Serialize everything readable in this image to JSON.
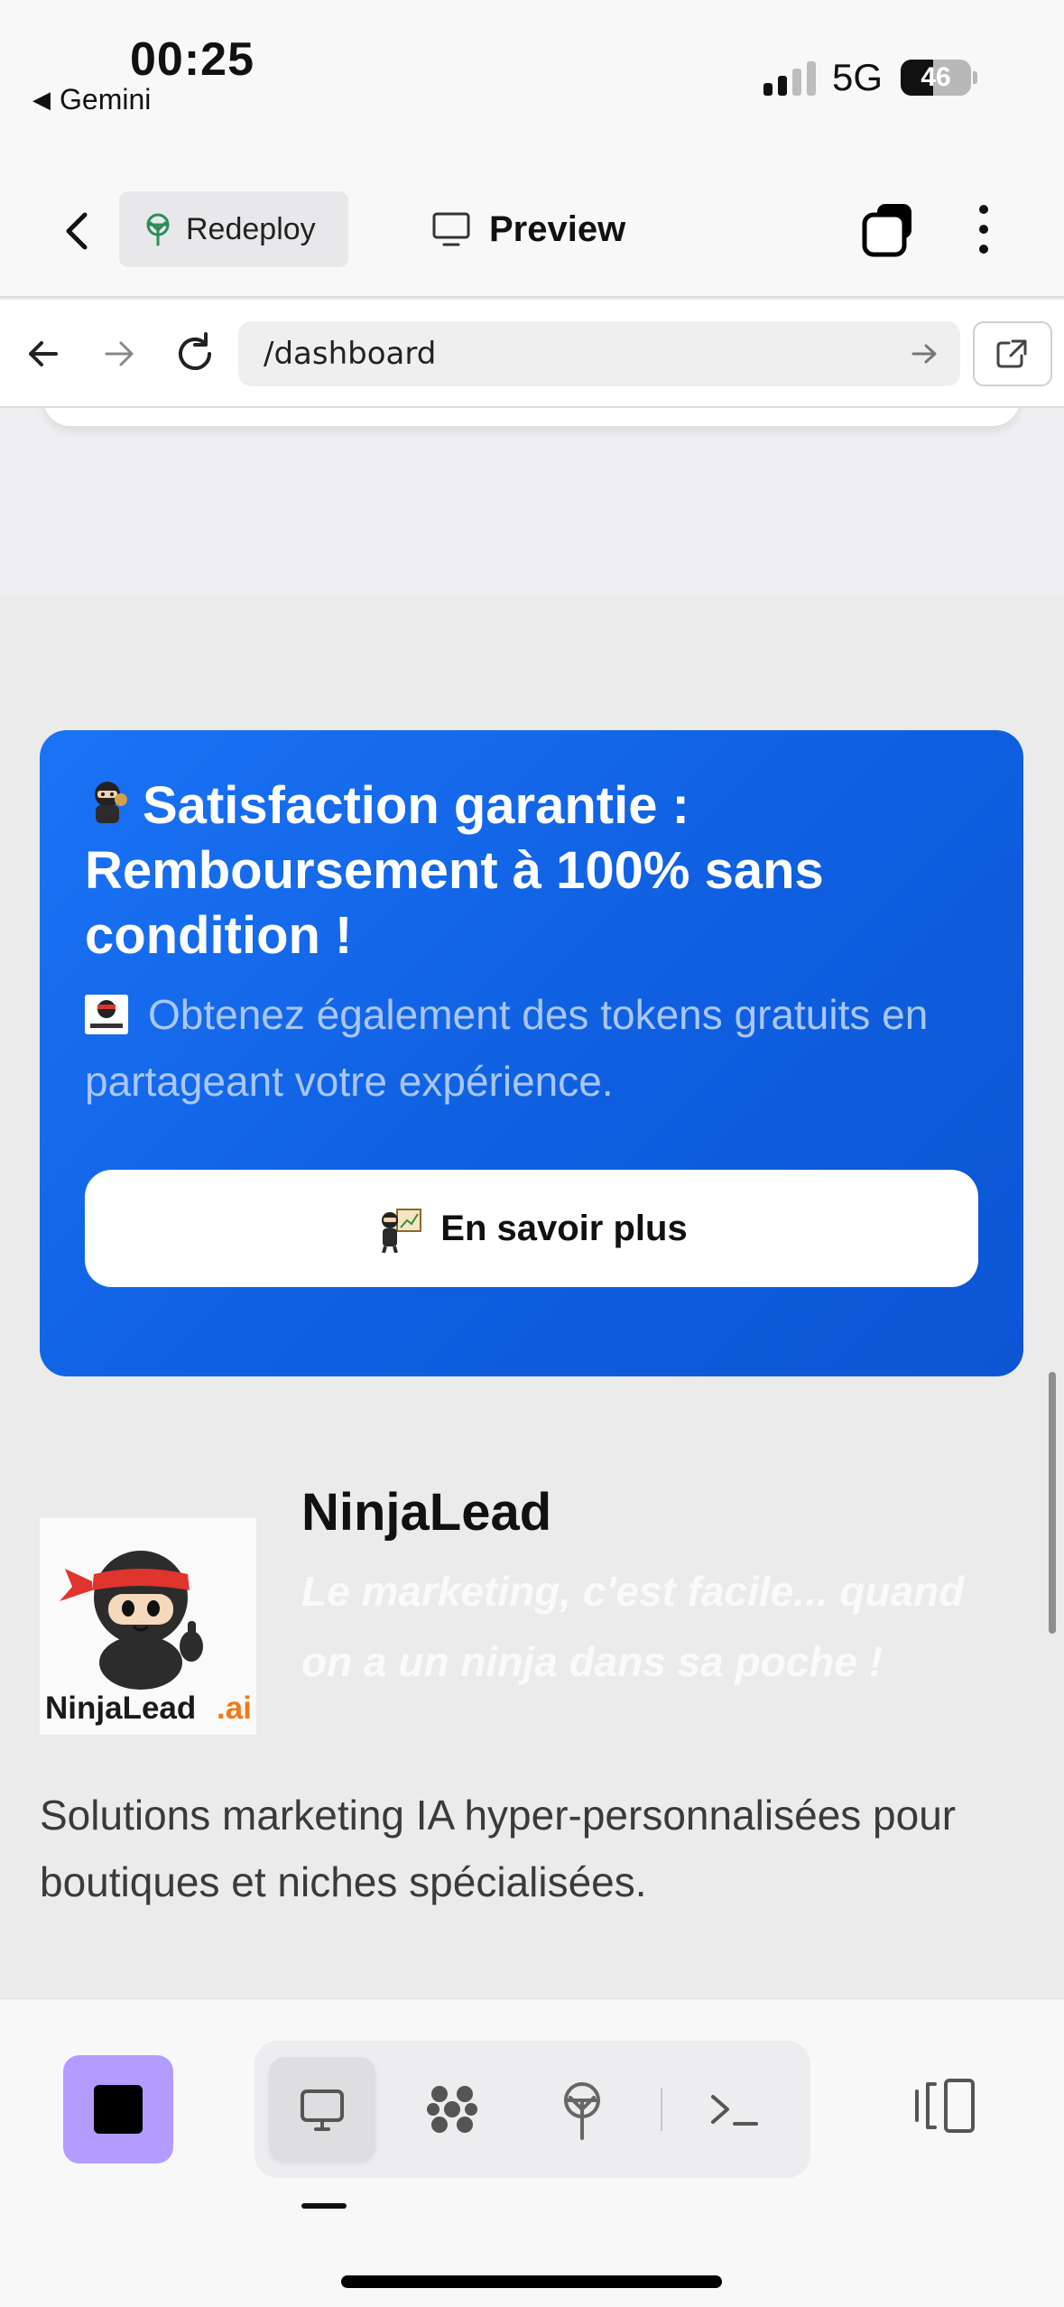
{
  "status_bar": {
    "time": "00:25",
    "back_app": "Gemini",
    "network": "5G",
    "battery": "46"
  },
  "header": {
    "redeploy_label": "Redeploy",
    "preview_label": "Preview"
  },
  "browser": {
    "url": "/dashboard"
  },
  "promo": {
    "title": "Satisfaction garantie : Remboursement à 100% sans condition !",
    "subtitle": "Obtenez également des tokens gratuits en partageant votre expérience.",
    "button_label": "En savoir plus"
  },
  "brand": {
    "name": "NinjaLead",
    "tagline": "Le marketing, c'est facile... quand on a un ninja dans sa poche !",
    "description": "Solutions marketing IA hyper-personnalisées pour boutiques et niches spécialisées.",
    "logo_text_main": "NinjaLead",
    "logo_text_suffix": ".ai"
  },
  "colors": {
    "promo_blue": "#1b73f5",
    "stop_purple": "#b39cff",
    "logo_orange": "#f07a1a",
    "ninja_red": "#e0342e"
  },
  "icons": {
    "header": [
      "chevron-left-icon",
      "sprout-icon",
      "monitor-icon",
      "tabs-icon",
      "more-vertical-icon"
    ],
    "browser": [
      "arrow-left-icon",
      "arrow-right-icon",
      "reload-icon",
      "arrow-right-icon",
      "external-link-icon"
    ],
    "toolbar": [
      "stop-icon",
      "monitor-icon",
      "apps-icon",
      "sprout-icon",
      "terminal-icon",
      "split-view-icon"
    ]
  }
}
